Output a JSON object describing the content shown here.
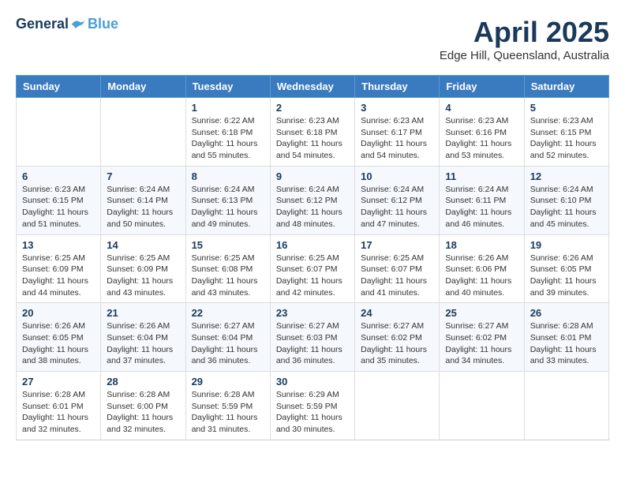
{
  "header": {
    "logo_general": "General",
    "logo_blue": "Blue",
    "title": "April 2025",
    "subtitle": "Edge Hill, Queensland, Australia"
  },
  "calendar": {
    "days": [
      "Sunday",
      "Monday",
      "Tuesday",
      "Wednesday",
      "Thursday",
      "Friday",
      "Saturday"
    ],
    "weeks": [
      [
        {
          "day": "",
          "content": ""
        },
        {
          "day": "",
          "content": ""
        },
        {
          "day": "1",
          "content": "Sunrise: 6:22 AM\nSunset: 6:18 PM\nDaylight: 11 hours and 55 minutes."
        },
        {
          "day": "2",
          "content": "Sunrise: 6:23 AM\nSunset: 6:18 PM\nDaylight: 11 hours and 54 minutes."
        },
        {
          "day": "3",
          "content": "Sunrise: 6:23 AM\nSunset: 6:17 PM\nDaylight: 11 hours and 54 minutes."
        },
        {
          "day": "4",
          "content": "Sunrise: 6:23 AM\nSunset: 6:16 PM\nDaylight: 11 hours and 53 minutes."
        },
        {
          "day": "5",
          "content": "Sunrise: 6:23 AM\nSunset: 6:15 PM\nDaylight: 11 hours and 52 minutes."
        }
      ],
      [
        {
          "day": "6",
          "content": "Sunrise: 6:23 AM\nSunset: 6:15 PM\nDaylight: 11 hours and 51 minutes."
        },
        {
          "day": "7",
          "content": "Sunrise: 6:24 AM\nSunset: 6:14 PM\nDaylight: 11 hours and 50 minutes."
        },
        {
          "day": "8",
          "content": "Sunrise: 6:24 AM\nSunset: 6:13 PM\nDaylight: 11 hours and 49 minutes."
        },
        {
          "day": "9",
          "content": "Sunrise: 6:24 AM\nSunset: 6:12 PM\nDaylight: 11 hours and 48 minutes."
        },
        {
          "day": "10",
          "content": "Sunrise: 6:24 AM\nSunset: 6:12 PM\nDaylight: 11 hours and 47 minutes."
        },
        {
          "day": "11",
          "content": "Sunrise: 6:24 AM\nSunset: 6:11 PM\nDaylight: 11 hours and 46 minutes."
        },
        {
          "day": "12",
          "content": "Sunrise: 6:24 AM\nSunset: 6:10 PM\nDaylight: 11 hours and 45 minutes."
        }
      ],
      [
        {
          "day": "13",
          "content": "Sunrise: 6:25 AM\nSunset: 6:09 PM\nDaylight: 11 hours and 44 minutes."
        },
        {
          "day": "14",
          "content": "Sunrise: 6:25 AM\nSunset: 6:09 PM\nDaylight: 11 hours and 43 minutes."
        },
        {
          "day": "15",
          "content": "Sunrise: 6:25 AM\nSunset: 6:08 PM\nDaylight: 11 hours and 43 minutes."
        },
        {
          "day": "16",
          "content": "Sunrise: 6:25 AM\nSunset: 6:07 PM\nDaylight: 11 hours and 42 minutes."
        },
        {
          "day": "17",
          "content": "Sunrise: 6:25 AM\nSunset: 6:07 PM\nDaylight: 11 hours and 41 minutes."
        },
        {
          "day": "18",
          "content": "Sunrise: 6:26 AM\nSunset: 6:06 PM\nDaylight: 11 hours and 40 minutes."
        },
        {
          "day": "19",
          "content": "Sunrise: 6:26 AM\nSunset: 6:05 PM\nDaylight: 11 hours and 39 minutes."
        }
      ],
      [
        {
          "day": "20",
          "content": "Sunrise: 6:26 AM\nSunset: 6:05 PM\nDaylight: 11 hours and 38 minutes."
        },
        {
          "day": "21",
          "content": "Sunrise: 6:26 AM\nSunset: 6:04 PM\nDaylight: 11 hours and 37 minutes."
        },
        {
          "day": "22",
          "content": "Sunrise: 6:27 AM\nSunset: 6:04 PM\nDaylight: 11 hours and 36 minutes."
        },
        {
          "day": "23",
          "content": "Sunrise: 6:27 AM\nSunset: 6:03 PM\nDaylight: 11 hours and 36 minutes."
        },
        {
          "day": "24",
          "content": "Sunrise: 6:27 AM\nSunset: 6:02 PM\nDaylight: 11 hours and 35 minutes."
        },
        {
          "day": "25",
          "content": "Sunrise: 6:27 AM\nSunset: 6:02 PM\nDaylight: 11 hours and 34 minutes."
        },
        {
          "day": "26",
          "content": "Sunrise: 6:28 AM\nSunset: 6:01 PM\nDaylight: 11 hours and 33 minutes."
        }
      ],
      [
        {
          "day": "27",
          "content": "Sunrise: 6:28 AM\nSunset: 6:01 PM\nDaylight: 11 hours and 32 minutes."
        },
        {
          "day": "28",
          "content": "Sunrise: 6:28 AM\nSunset: 6:00 PM\nDaylight: 11 hours and 32 minutes."
        },
        {
          "day": "29",
          "content": "Sunrise: 6:28 AM\nSunset: 5:59 PM\nDaylight: 11 hours and 31 minutes."
        },
        {
          "day": "30",
          "content": "Sunrise: 6:29 AM\nSunset: 5:59 PM\nDaylight: 11 hours and 30 minutes."
        },
        {
          "day": "",
          "content": ""
        },
        {
          "day": "",
          "content": ""
        },
        {
          "day": "",
          "content": ""
        }
      ]
    ]
  }
}
